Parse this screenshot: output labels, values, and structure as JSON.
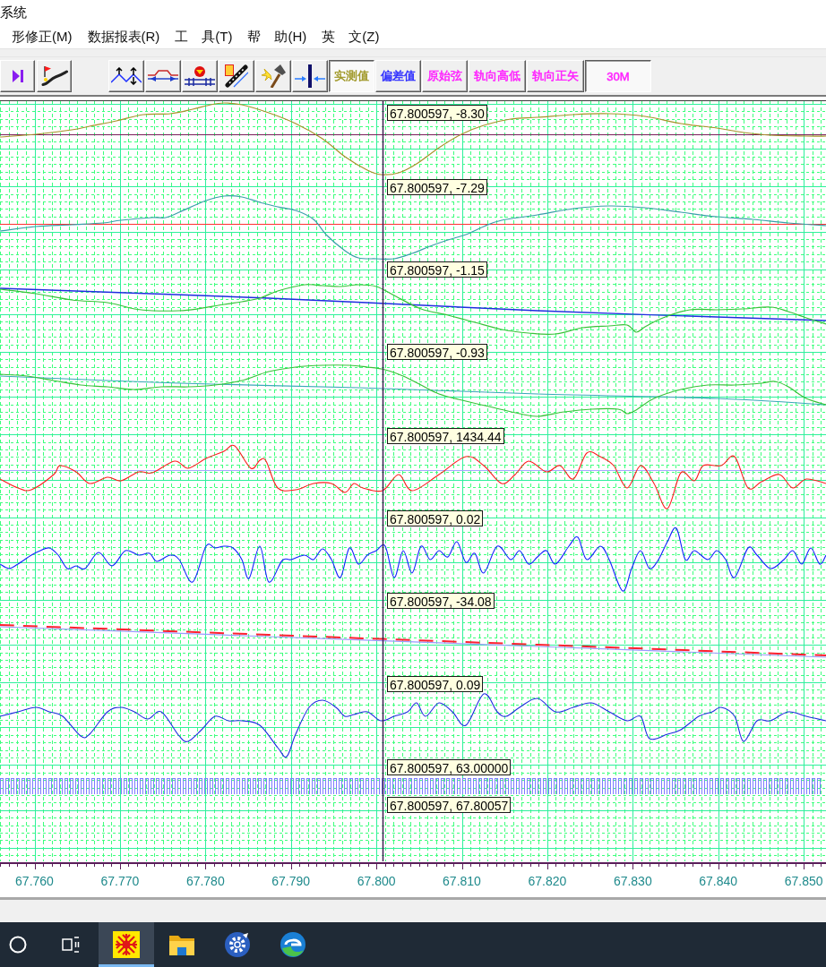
{
  "window": {
    "title": "系统"
  },
  "menu": [
    {
      "label": "形修正(M)"
    },
    {
      "label": "数据报表(R)"
    },
    {
      "label": "工　具(T)"
    },
    {
      "label": "帮　助(H)"
    },
    {
      "label": "英　文(Z)"
    }
  ],
  "toolbar": {
    "groups": [
      {
        "buttons": [
          {
            "kind": "skip",
            "pressed": false
          },
          {
            "kind": "flag",
            "pressed": false
          }
        ]
      },
      {
        "buttons": [
          {
            "kind": "zigzag",
            "pressed": false
          },
          {
            "kind": "bump",
            "pressed": false
          },
          {
            "kind": "pin",
            "pressed": false
          },
          {
            "kind": "ladder",
            "pressed": false
          },
          {
            "kind": "hammer",
            "pressed": false
          },
          {
            "kind": "converge",
            "pressed": false
          },
          {
            "kind": "text",
            "label": "实测值",
            "pressed": true,
            "color": "#a09828"
          },
          {
            "kind": "text",
            "label": "偏差值",
            "pressed": false,
            "color": "#2a2aff"
          },
          {
            "kind": "text",
            "label": "原始弦",
            "pressed": false,
            "color": "#ff20ff"
          },
          {
            "kind": "text",
            "label": "轨向高低",
            "pressed": false,
            "color": "#ff20ff"
          },
          {
            "kind": "text",
            "label": "轨向正矢",
            "pressed": false,
            "color": "#ff20ff"
          },
          {
            "kind": "text",
            "label": "30M",
            "pressed": true,
            "color": "#ff20ff"
          }
        ]
      }
    ]
  },
  "chart": {
    "tracks": [
      {
        "readout": "67.800597, -8.30"
      },
      {
        "readout": "67.800597, -7.29"
      },
      {
        "readout": "67.800597, -1.15"
      },
      {
        "readout": "67.800597, -0.93"
      },
      {
        "readout": "67.800597, 1434.44"
      },
      {
        "readout": "67.800597, 0.02"
      },
      {
        "readout": "67.800597, -34.08"
      },
      {
        "readout": "67.800597, 0.09"
      },
      {
        "readout": "67.800597, 63.00000"
      },
      {
        "readout": "67.800597, 67.80057"
      }
    ],
    "axis_labels": [
      "67.760",
      "67.770",
      "67.780",
      "67.790",
      "67.800",
      "67.810",
      "67.820",
      "67.830",
      "67.840",
      "67.850"
    ]
  },
  "taskbar": {
    "items": [
      {
        "kind": "circle",
        "selected": false
      },
      {
        "kind": "taskview",
        "selected": false
      },
      {
        "kind": "app",
        "selected": true
      },
      {
        "kind": "folder",
        "selected": false
      },
      {
        "kind": "gear",
        "selected": false
      },
      {
        "kind": "browser",
        "selected": false
      }
    ]
  }
}
